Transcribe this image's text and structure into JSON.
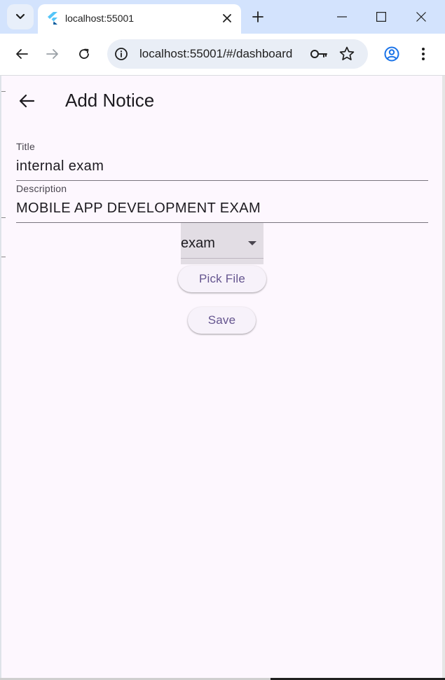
{
  "browser": {
    "tab": {
      "title": "localhost:55001"
    },
    "url": "localhost:55001/#/dashboard"
  },
  "page": {
    "title": "Add Notice",
    "fields": {
      "title": {
        "label": "Title",
        "value": "internal exam"
      },
      "description": {
        "label": "Description",
        "value": "MOBILE APP DEVELOPMENT EXAM"
      }
    },
    "category_dropdown": {
      "selected": "exam"
    },
    "pick_file_label": "Pick File",
    "save_label": "Save"
  },
  "colors": {
    "page_background": "#fdf7fe",
    "button_text": "#65558f",
    "chrome_titlebar": "#d3e3fd",
    "profile_icon": "#1a73e8"
  }
}
